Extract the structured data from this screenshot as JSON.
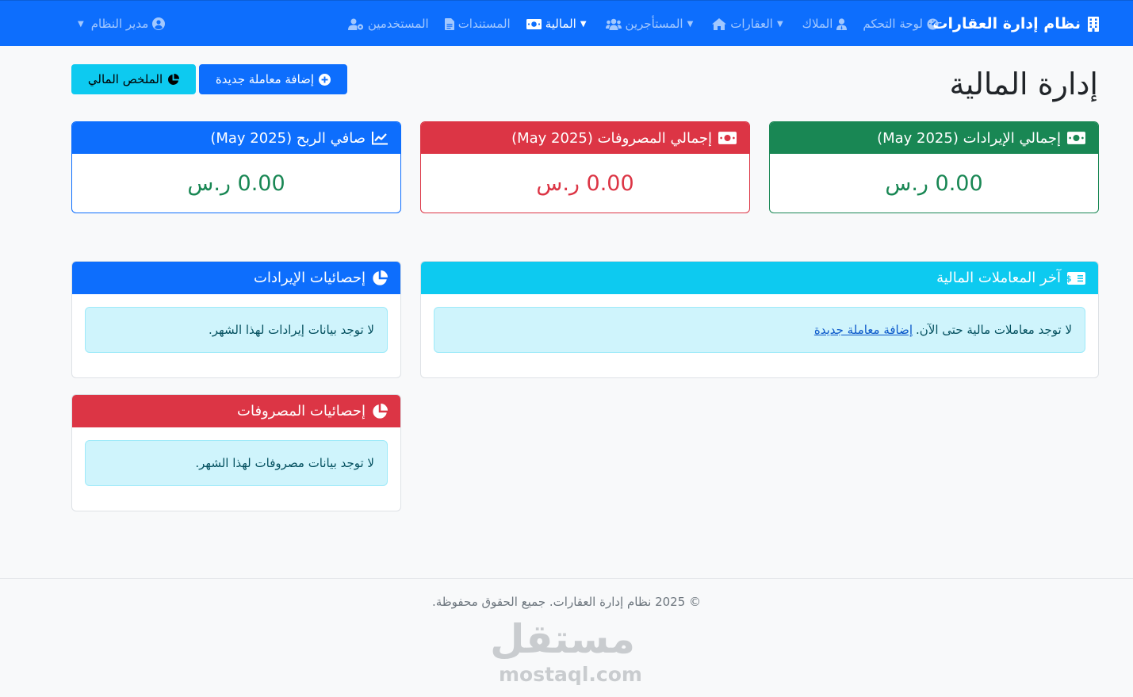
{
  "navbar": {
    "brand": "نظام إدارة العقارات",
    "items": [
      {
        "label": "لوحة التحكم",
        "icon": "dashboard-icon"
      },
      {
        "label": "الملاك",
        "icon": "user-tie-icon"
      },
      {
        "label": "العقارات",
        "icon": "home-icon"
      },
      {
        "label": "المستأجرين",
        "icon": "users-icon"
      },
      {
        "label": "المالية",
        "icon": "money-bill-icon"
      },
      {
        "label": "المستندات",
        "icon": "file-icon"
      },
      {
        "label": "المستخدمين",
        "icon": "users-cog-icon"
      }
    ],
    "user": "مدير النظام"
  },
  "page": {
    "title": "إدارة المالية",
    "add_transaction": "إضافة معاملة جديدة",
    "financial_summary": "الملخص المالي"
  },
  "stats": {
    "revenue_title": "إجمالي الإيرادات (May 2025)",
    "revenue_value": "0.00 ر.س",
    "expenses_title": "إجمالي المصروفات (May 2025)",
    "expenses_value": "0.00 ر.س",
    "profit_title": "صافي الربح (May 2025)",
    "profit_value": "0.00 ر.س"
  },
  "panels": {
    "latest_title": "آخر المعاملات المالية",
    "latest_empty": "لا توجد معاملات مالية حتى الآن.",
    "latest_link": "إضافة معاملة جديدة",
    "revenue_stats_title": "إحصائيات الإيرادات",
    "revenue_stats_empty": "لا توجد بيانات إيرادات لهذا الشهر.",
    "expense_stats_title": "إحصائيات المصروفات",
    "expense_stats_empty": "لا توجد بيانات مصروفات لهذا الشهر."
  },
  "footer": {
    "copyright": "© 2025 نظام إدارة العقارات. جميع الحقوق محفوظة.",
    "watermark_ar": "مستقل",
    "watermark_en": "mostaql.com"
  },
  "colors": {
    "primary": "#0d6efd",
    "success": "#198754",
    "danger": "#dc3545",
    "info": "#0dcaf0"
  }
}
